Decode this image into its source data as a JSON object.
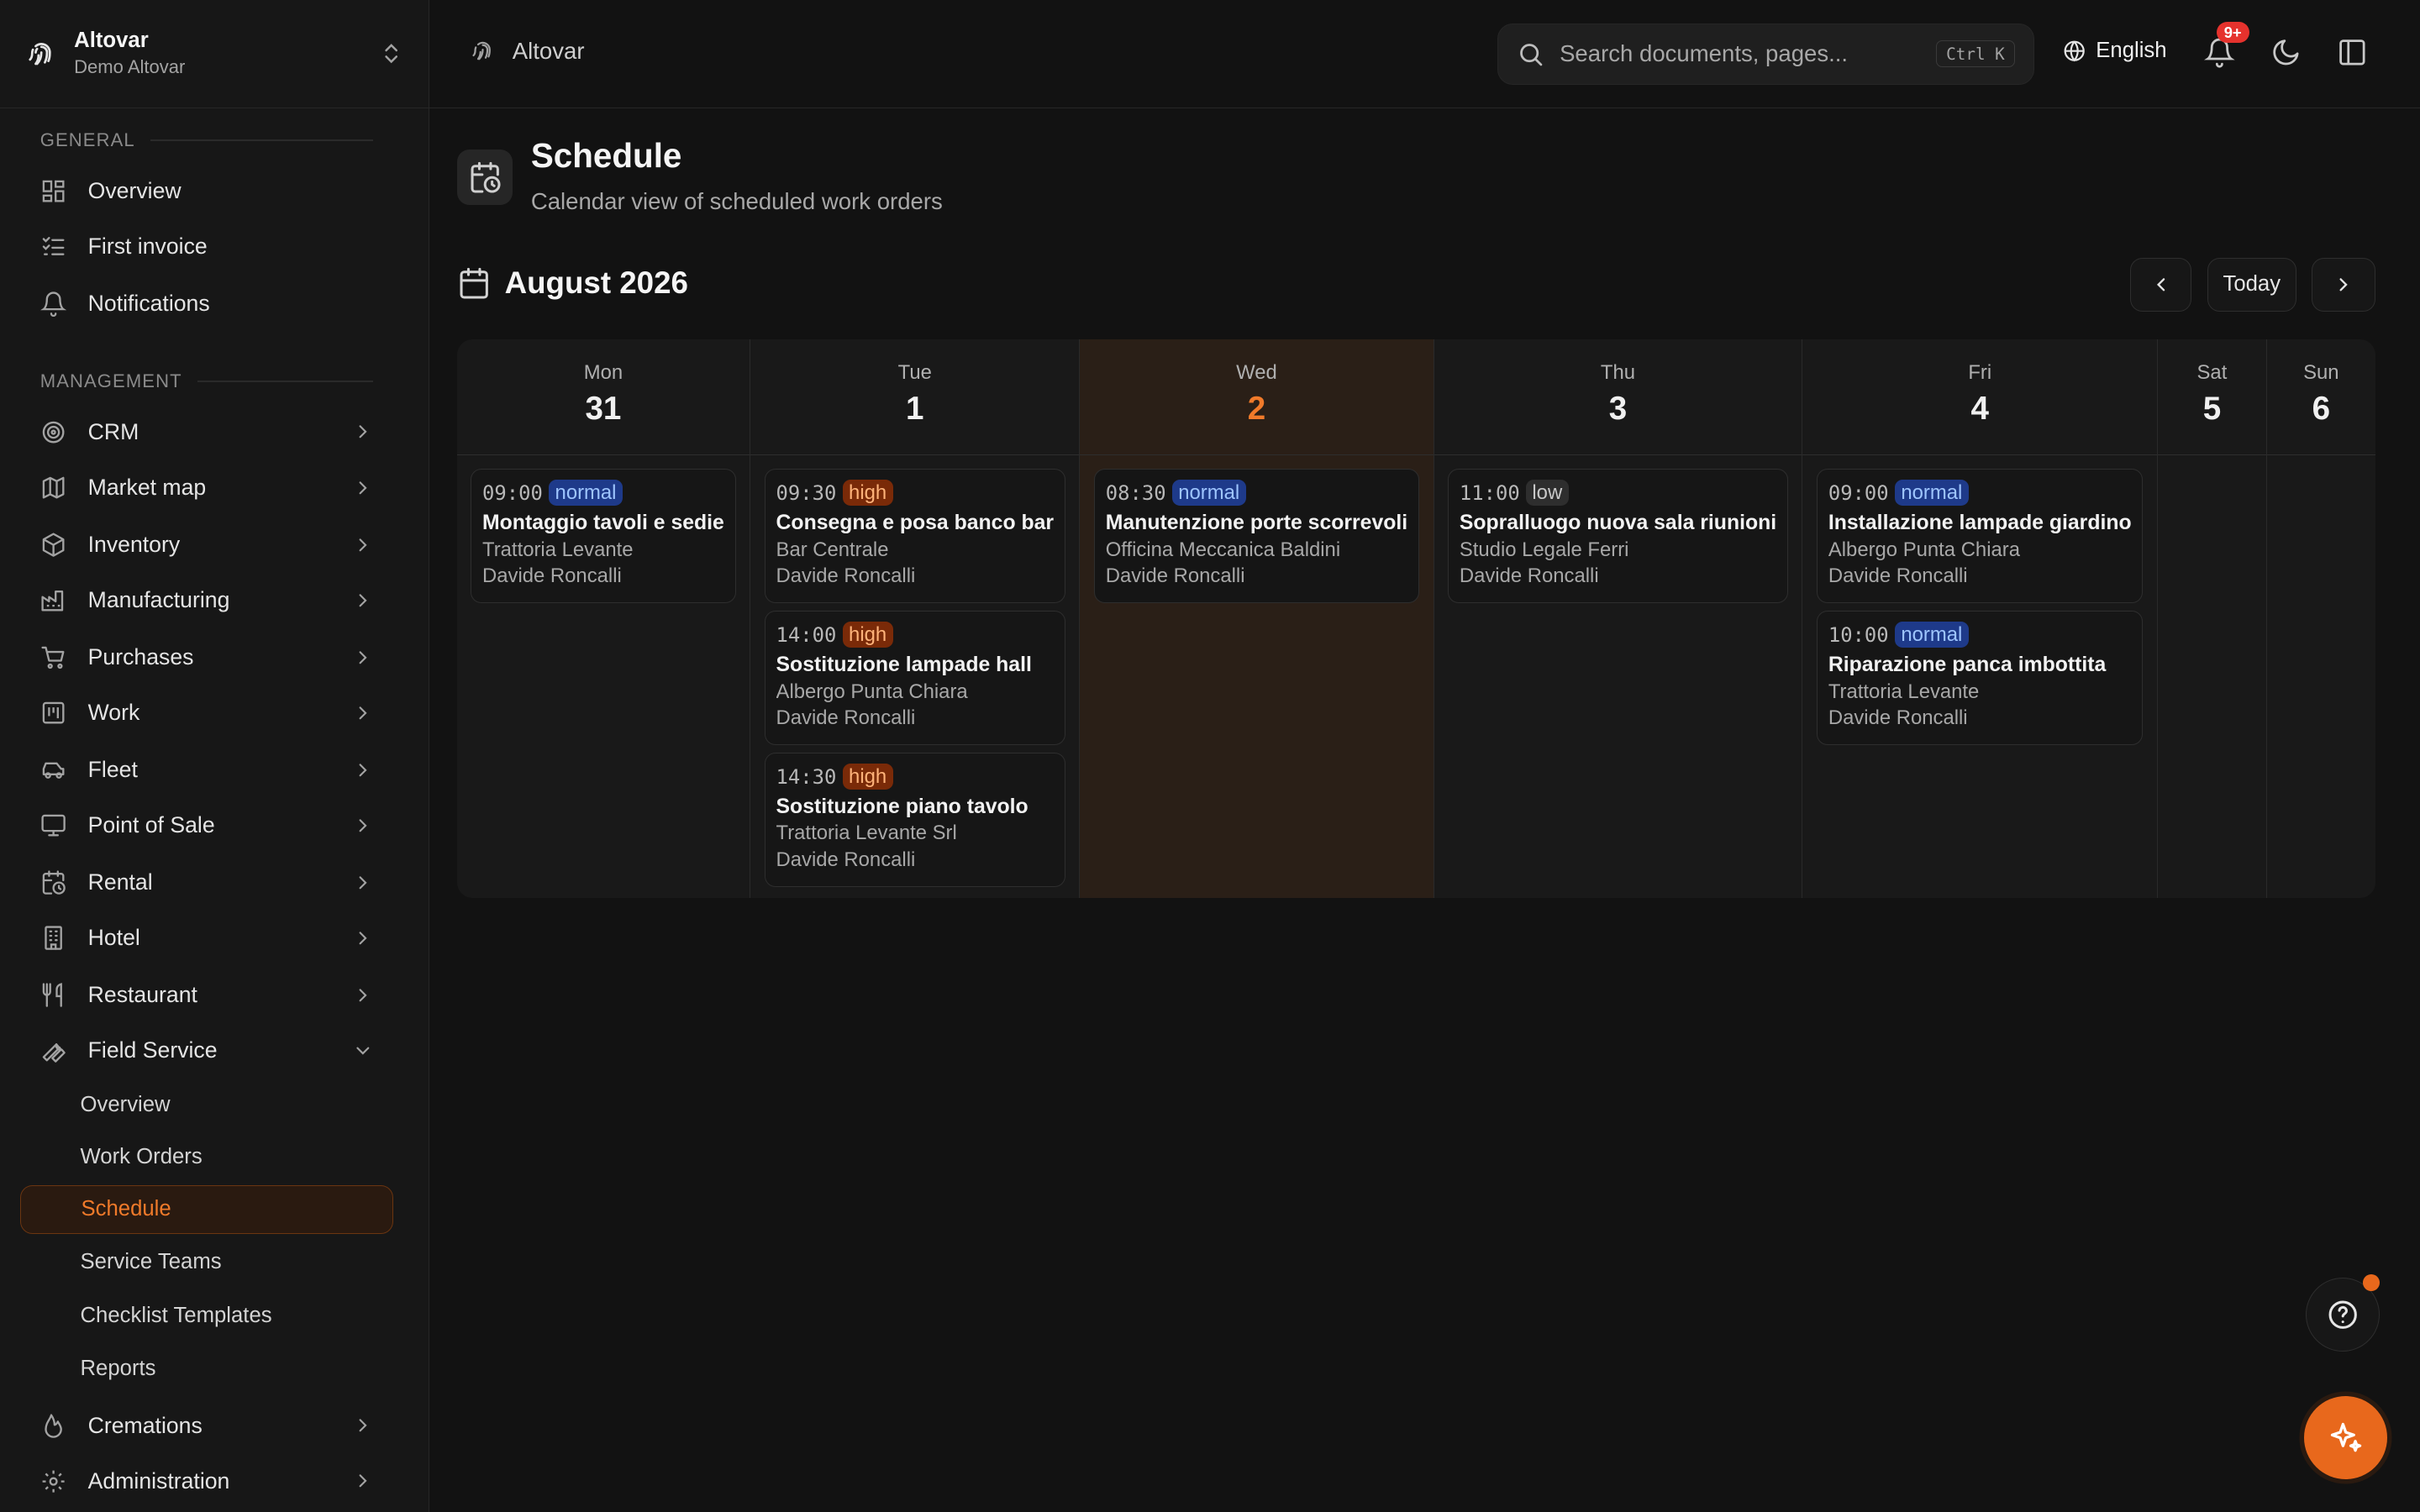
{
  "org": {
    "name": "Altovar",
    "subtitle": "Demo Altovar"
  },
  "topbar": {
    "breadcrumb": "Altovar",
    "search_placeholder": "Search documents, pages...",
    "search_shortcut": "Ctrl K",
    "language": "English",
    "notification_badge": "9+"
  },
  "sidebar": {
    "general_label": "GENERAL",
    "general_items": [
      {
        "label": "Overview",
        "icon": "dashboard-icon"
      },
      {
        "label": "First invoice",
        "icon": "checklist-icon"
      },
      {
        "label": "Notifications",
        "icon": "bell-icon"
      }
    ],
    "management_label": "MANAGEMENT",
    "management_items": [
      {
        "label": "CRM",
        "icon": "target-icon"
      },
      {
        "label": "Market map",
        "icon": "map-icon"
      },
      {
        "label": "Inventory",
        "icon": "box-icon"
      },
      {
        "label": "Manufacturing",
        "icon": "factory-icon"
      },
      {
        "label": "Purchases",
        "icon": "cart-icon"
      },
      {
        "label": "Work",
        "icon": "kanban-icon"
      },
      {
        "label": "Fleet",
        "icon": "car-icon"
      },
      {
        "label": "Point of Sale",
        "icon": "monitor-icon"
      },
      {
        "label": "Rental",
        "icon": "calendar-clock-icon"
      },
      {
        "label": "Hotel",
        "icon": "building-icon"
      },
      {
        "label": "Restaurant",
        "icon": "utensils-icon"
      },
      {
        "label": "Field Service",
        "icon": "wrench-icon"
      }
    ],
    "field_service_sub": [
      "Overview",
      "Work Orders",
      "Schedule",
      "Service Teams",
      "Checklist Templates",
      "Reports"
    ],
    "bottom_items": [
      {
        "label": "Cremations",
        "icon": "flame-icon"
      },
      {
        "label": "Administration",
        "icon": "gear-icon"
      }
    ]
  },
  "page": {
    "title": "Schedule",
    "subtitle": "Calendar view of scheduled work orders",
    "month": "August 2026",
    "today_label": "Today"
  },
  "calendar": {
    "days": [
      {
        "name": "Mon",
        "date": "31",
        "today": false,
        "events": [
          {
            "time": "09:00",
            "priority": "normal",
            "title": "Montaggio tavoli e sedie",
            "customer": "Trattoria Levante",
            "tech": "Davide Roncalli"
          }
        ]
      },
      {
        "name": "Tue",
        "date": "1",
        "today": false,
        "events": [
          {
            "time": "09:30",
            "priority": "high",
            "title": "Consegna e posa banco bar",
            "customer": "Bar Centrale",
            "tech": "Davide Roncalli"
          },
          {
            "time": "14:00",
            "priority": "high",
            "title": "Sostituzione lampade hall",
            "customer": "Albergo Punta Chiara",
            "tech": "Davide Roncalli"
          },
          {
            "time": "14:30",
            "priority": "high",
            "title": "Sostituzione piano tavolo",
            "customer": "Trattoria Levante Srl",
            "tech": "Davide Roncalli"
          }
        ]
      },
      {
        "name": "Wed",
        "date": "2",
        "today": true,
        "events": [
          {
            "time": "08:30",
            "priority": "normal",
            "title": "Manutenzione porte scorrevoli",
            "customer": "Officina Meccanica Baldini",
            "tech": "Davide Roncalli"
          }
        ]
      },
      {
        "name": "Thu",
        "date": "3",
        "today": false,
        "events": [
          {
            "time": "11:00",
            "priority": "low",
            "title": "Sopralluogo nuova sala riunioni",
            "customer": "Studio Legale Ferri",
            "tech": "Davide Roncalli"
          }
        ]
      },
      {
        "name": "Fri",
        "date": "4",
        "today": false,
        "events": [
          {
            "time": "09:00",
            "priority": "normal",
            "title": "Installazione lampade giardino",
            "customer": "Albergo Punta Chiara",
            "tech": "Davide Roncalli"
          },
          {
            "time": "10:00",
            "priority": "normal",
            "title": "Riparazione panca imbottita",
            "customer": "Trattoria Levante",
            "tech": "Davide Roncalli"
          }
        ]
      },
      {
        "name": "Sat",
        "date": "5",
        "today": false,
        "events": []
      },
      {
        "name": "Sun",
        "date": "6",
        "today": false,
        "events": []
      }
    ]
  },
  "colors": {
    "accent": "#e8681c",
    "background": "#121212",
    "sidebar": "#171717"
  }
}
